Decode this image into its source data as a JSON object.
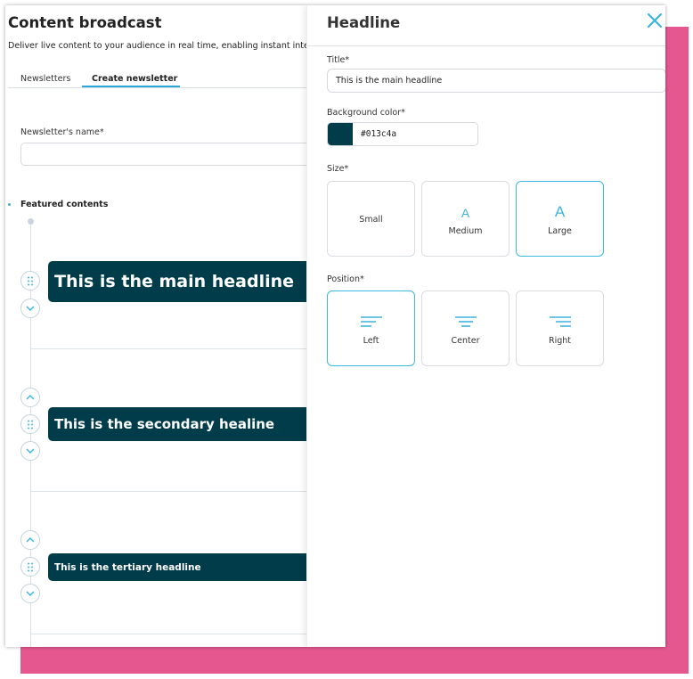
{
  "page": {
    "title": "Content broadcast",
    "subtitle": "Deliver live content to your audience in real time, enabling instant interaction"
  },
  "tabs": [
    {
      "label": "Newsletters",
      "active": false
    },
    {
      "label": "Create newsletter",
      "active": true
    }
  ],
  "form": {
    "name_label": "Newsletter's name*",
    "name_value": "",
    "featured_label": "Featured contents"
  },
  "headlines": [
    {
      "text": "This is the main headline",
      "size": "large"
    },
    {
      "text": "This is the secondary healine",
      "size": "medium"
    },
    {
      "text": "This is the tertiary headline",
      "size": "small"
    }
  ],
  "panel": {
    "title": "Headline",
    "title_label": "Title*",
    "title_value": "This is the main headline",
    "bg_label": "Background color*",
    "bg_value": "#013c4a",
    "size_label": "Size*",
    "size_options": [
      {
        "label": "Small",
        "glyph": ""
      },
      {
        "label": "Medium",
        "glyph": "A"
      },
      {
        "label": "Large",
        "glyph": "A"
      }
    ],
    "size_selected": "Large",
    "position_label": "Position*",
    "position_options": [
      {
        "label": "Left"
      },
      {
        "label": "Center"
      },
      {
        "label": "Right"
      }
    ],
    "position_selected": "Left"
  },
  "colors": {
    "accent": "#3db4dd",
    "card": "#013c4a",
    "backdrop": "#e4578f"
  }
}
